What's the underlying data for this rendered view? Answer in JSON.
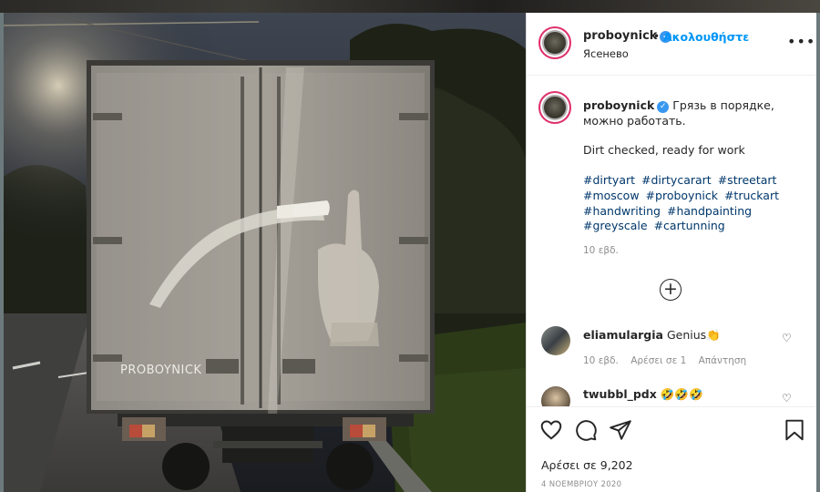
{
  "post": {
    "username": "proboynick",
    "follow_label": "Ακολουθήστε",
    "location": "Ясенево",
    "caption_ru": "Грязь в порядке, можно работать.",
    "caption_en": "Dirt checked, ready for work",
    "hashtags": [
      "#dirtyart",
      "#dirtycarart",
      "#streetart",
      "#moscow",
      "#proboynick",
      "#truckart",
      "#handwriting",
      "#handpainting",
      "#greyscale",
      "#cartunning"
    ],
    "caption_time": "10 εβδ.",
    "truck_signature": "PROBOYNICK"
  },
  "comments": [
    {
      "username": "eliamulargia",
      "text": "Genius👏",
      "time": "10 εβδ.",
      "likes": "Αρέσει σε 1",
      "reply": "Απάντηση"
    },
    {
      "username": "twubbl_pdx",
      "text": "🤣🤣🤣",
      "time": "",
      "likes": "",
      "reply": ""
    }
  ],
  "footer": {
    "likes": "Αρέσει σε 9,202",
    "date": "4 ΝΟΕΜΒΡΙΟΥ 2020"
  },
  "icons": {
    "more": "more-options-icon",
    "add_comment": "plus-circle-icon",
    "like": "heart-icon",
    "comment": "comment-icon",
    "share": "share-icon",
    "save": "bookmark-icon",
    "verified": "verified-badge-icon"
  },
  "colors": {
    "link_blue": "#0095f6",
    "hashtag": "#00376b",
    "verified": "#3897f0",
    "muted": "#8e8e8e"
  }
}
